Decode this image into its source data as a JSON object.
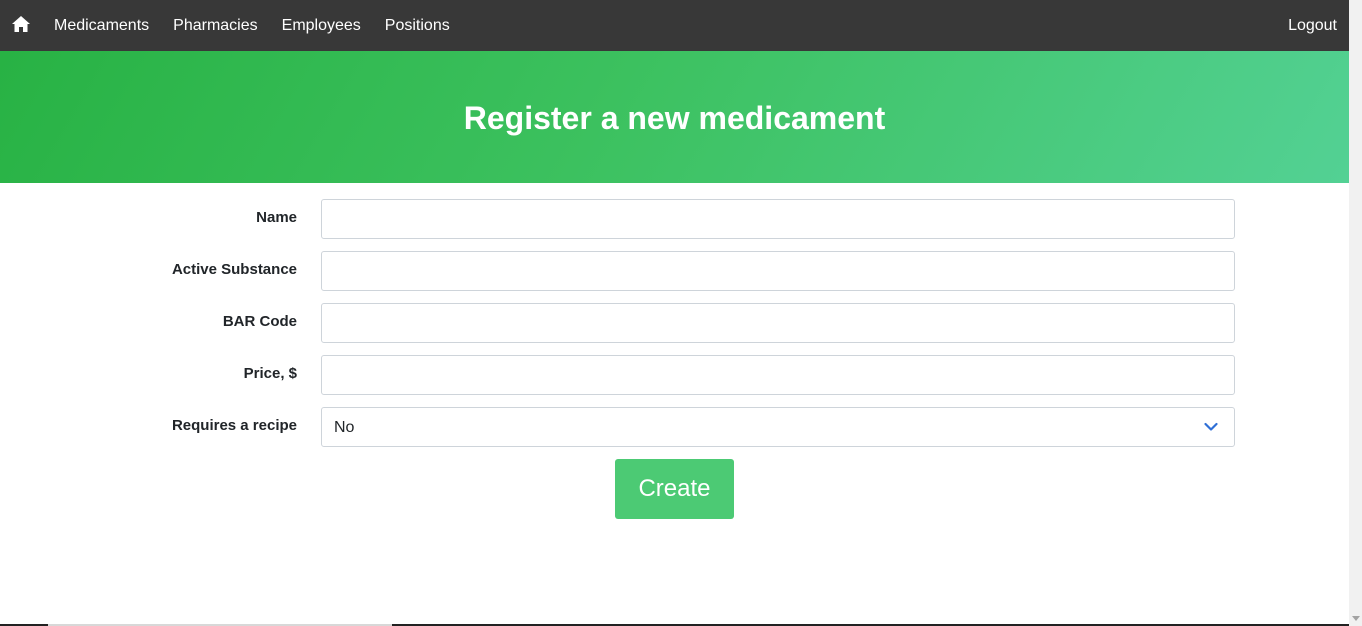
{
  "navbar": {
    "home_icon": "home-icon",
    "links": [
      "Medicaments",
      "Pharmacies",
      "Employees",
      "Positions"
    ],
    "logout": "Logout"
  },
  "hero": {
    "title": "Register a new medicament",
    "colors": [
      "#28b244",
      "#53d194"
    ]
  },
  "form": {
    "fields": [
      {
        "label": "Name",
        "value": "",
        "placeholder": ""
      },
      {
        "label": "Active Substance",
        "value": "",
        "placeholder": ""
      },
      {
        "label": "BAR Code",
        "value": "",
        "placeholder": ""
      },
      {
        "label": "Price, $",
        "value": "",
        "placeholder": ""
      }
    ],
    "recipe": {
      "label": "Requires a recipe",
      "selected": "No",
      "icon": "chevron-down-icon"
    },
    "submit_label": "Create"
  },
  "colors": {
    "navbar_bg": "#383838",
    "button_bg": "#4cca74",
    "chevron": "#2f6fd6"
  }
}
